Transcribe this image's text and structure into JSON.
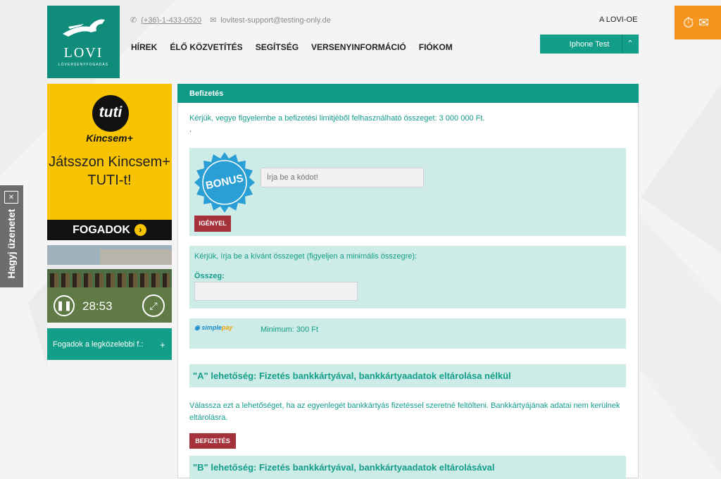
{
  "header": {
    "logo_brand": "LOVI",
    "logo_tagline": "LÓVERSENYFOGADÁS",
    "phone": "(+36)-1-433-0520",
    "email": "lovitest-support@testing-only.de",
    "top_right_text": "A LOVI-OE",
    "nav": [
      "HÍREK",
      "ÉLŐ KÖZVETÍTÉS",
      "SEGÍTSÉG",
      "VERSENYINFORMÁCIÓ",
      "FIÓKOM"
    ],
    "user_button": "Iphone Test",
    "icons": {
      "phone": "phone-icon",
      "email": "envelope-icon",
      "chevron": "chevron-up-icon",
      "stopwatch": "stopwatch-icon",
      "mail": "mail-icon"
    }
  },
  "feedback_tab": {
    "label": "Hagyj üzenetet"
  },
  "sidebar": {
    "ad": {
      "badge": "tuti",
      "brand": "Kincsem+",
      "headline_line1": "Játsszon Kincsem+",
      "headline_line2": "TUTI-t!",
      "cta": "FOGADOK",
      "bg_color": "#f8c300"
    },
    "video": {
      "time": "28:53"
    },
    "nearest": {
      "label": "Fogadok a legközelebbi f.:",
      "toggle": "+"
    }
  },
  "main": {
    "title": "Befizetés",
    "notice": "Kérjük, vegye figyelembe a befizetési limitjéből felhasználható összeget: 3 000 000 Ft.",
    "dot": ".",
    "bonus": {
      "badge_text": "BONUS",
      "code_placeholder": "Írja be a kódot!",
      "claim_button": "IGÉNYEL"
    },
    "amount": {
      "instruction": "Kérjük, írja be a kívánt összeget (figyeljen a minimális összegre):",
      "label": "Összeg:",
      "value": ""
    },
    "simplepay": {
      "logo_simple": "simple",
      "logo_pay": "pay",
      "minimum": "Minimum: 300 Ft"
    },
    "option_a": {
      "title": "\"A\" lehetőség: Fizetés bankkártyával, bankkártyaadatok eltárolása nélkül",
      "description": "Válassza ezt a lehetőséget, ha az egyenlegét bankkártyás fizetéssel szeretné feltölteni. Bankkártyájának adatai nem kerülnek eltárolásra.",
      "button": "BEFIZETÉS"
    },
    "option_b": {
      "title": "\"B\" lehetőség: Fizetés bankkártyával, bankkártyaadatok eltárolásával"
    },
    "colors": {
      "accent": "#129e88",
      "button_red": "#a5313b",
      "box_bg": "#cdebe7"
    }
  }
}
